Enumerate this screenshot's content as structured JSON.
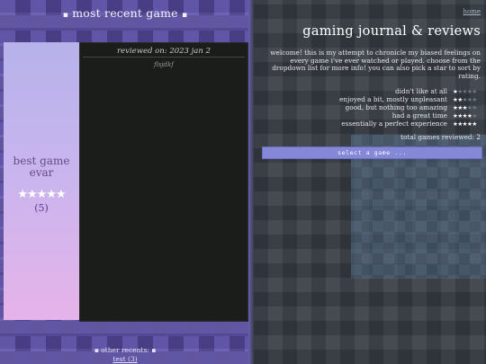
{
  "left": {
    "recent_title": "most recent game",
    "featured": {
      "game_name": "best game evar",
      "stars": "★★★★★",
      "rating_label": "(5)"
    },
    "review": {
      "date": "reviewed on: 2023 jan 2",
      "text": "flsjdkf"
    },
    "other_recents_label": "other recents:",
    "other_recents_items": [
      "test (3)"
    ]
  },
  "right": {
    "home_link": "home",
    "title": "gaming journal & reviews",
    "intro": "welcome! this is my attempt to chronicle my biased feelings on every game i've ever watched or played. choose from the dropdown list for more info! you can also pick a star to sort by rating.",
    "legend": [
      {
        "label": "didn't like at all",
        "filled": 1
      },
      {
        "label": "enjoyed a bit, mostly unpleasant",
        "filled": 2
      },
      {
        "label": "good, but nothing too amazing",
        "filled": 3
      },
      {
        "label": "had a great time",
        "filled": 4
      },
      {
        "label": "essentially a perfect experience",
        "filled": 5
      }
    ],
    "total_label": "total games reviewed:",
    "total_count": "2",
    "select_placeholder": "select a game ..."
  },
  "colors": {
    "left_bg": "#514494",
    "card_gradient_top": "#b7b2ea",
    "card_gradient_bottom": "#e6b3ea",
    "review_bg": "#1b1d1b",
    "right_bg": "#3a3f47",
    "select_bg": "#8588d6"
  }
}
